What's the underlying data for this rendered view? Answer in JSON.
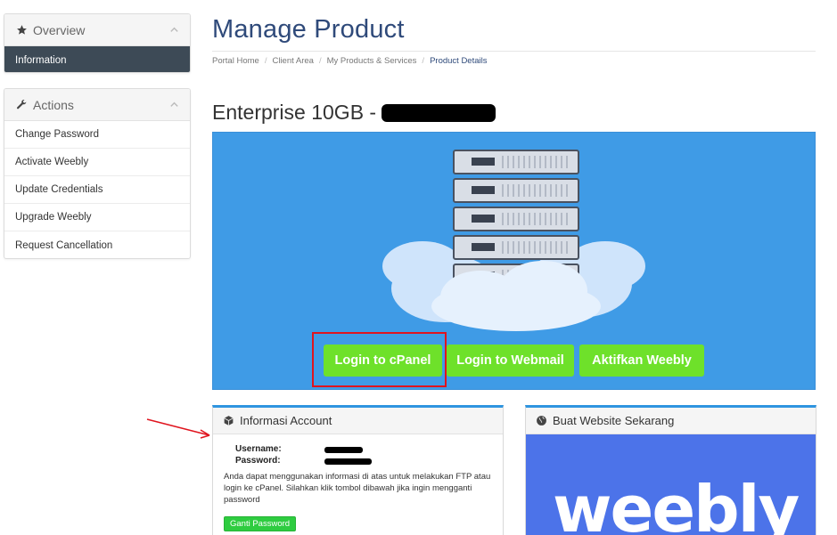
{
  "sidebar": {
    "overview": {
      "title": "Overview",
      "items": [
        {
          "label": "Information"
        }
      ]
    },
    "actions": {
      "title": "Actions",
      "items": [
        {
          "label": "Change Password"
        },
        {
          "label": "Activate Weebly"
        },
        {
          "label": "Update Credentials"
        },
        {
          "label": "Upgrade Weebly"
        },
        {
          "label": "Request Cancellation"
        }
      ]
    }
  },
  "header": {
    "title": "Manage Product",
    "breadcrumb": [
      "Portal Home",
      "Client Area",
      "My Products & Services",
      "Product Details"
    ]
  },
  "product": {
    "name": "Enterprise 10GB -"
  },
  "hero_buttons": {
    "cpanel": "Login to cPanel",
    "webmail": "Login to Webmail",
    "weebly": "Aktifkan Weebly"
  },
  "account_panel": {
    "title": "Informasi Account",
    "username_label": "Username:",
    "password_label": "Password:",
    "description": "Anda dapat menggunakan informasi di atas untuk melakukan FTP atau login ke cPanel. Silahkan klik tombol dibawah jika ingin mengganti password",
    "button": "Ganti Password"
  },
  "website_panel": {
    "title": "Buat Website Sekarang",
    "logo_text": "weebly"
  },
  "colors": {
    "accent_blue": "#2f4a7a",
    "hero_blue": "#3f9be6",
    "button_green": "#6ee12a",
    "highlight_red": "#e0141e",
    "weebly_blue": "#4c73e9"
  },
  "icons": {
    "overview": "star-icon",
    "actions": "wrench-icon",
    "account": "cube-icon",
    "website": "globe-icon"
  }
}
